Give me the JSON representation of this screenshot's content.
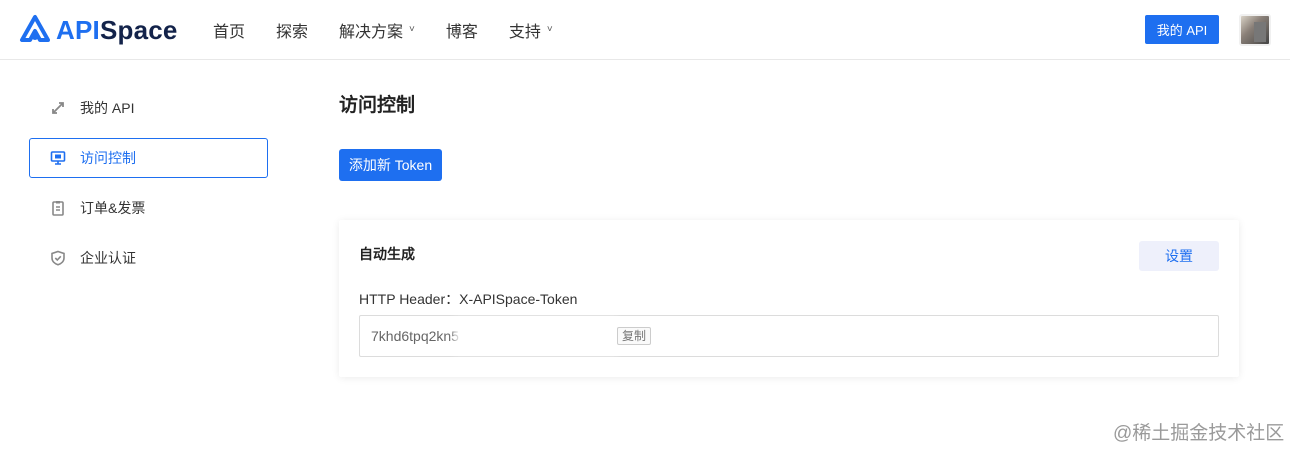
{
  "header": {
    "logo": {
      "api": "API",
      "space": "Space"
    },
    "nav": [
      {
        "label": "首页",
        "has_dropdown": false
      },
      {
        "label": "探索",
        "has_dropdown": false
      },
      {
        "label": "解决方案",
        "has_dropdown": true
      },
      {
        "label": "博客",
        "has_dropdown": false
      },
      {
        "label": "支持",
        "has_dropdown": true
      }
    ],
    "chevron": "˅",
    "my_api_button": "我的 API",
    "accent_color": "#1e6ff0"
  },
  "sidebar": {
    "items": [
      {
        "label": "我的 API",
        "icon": "arrows-icon",
        "active": false
      },
      {
        "label": "访问控制",
        "icon": "monitor-icon",
        "active": true
      },
      {
        "label": "订单&发票",
        "icon": "clipboard-icon",
        "active": false
      },
      {
        "label": "企业认证",
        "icon": "shield-check-icon",
        "active": false
      }
    ]
  },
  "main": {
    "title": "访问控制",
    "add_token_button": "添加新 Token",
    "card": {
      "title": "自动生成",
      "settings_button": "设置",
      "header_label": "HTTP Header：X-APISpace-Token",
      "token_visible": "7khd6tpq2kn5",
      "copy_button": "复制"
    }
  },
  "watermark": "@稀土掘金技术社区"
}
